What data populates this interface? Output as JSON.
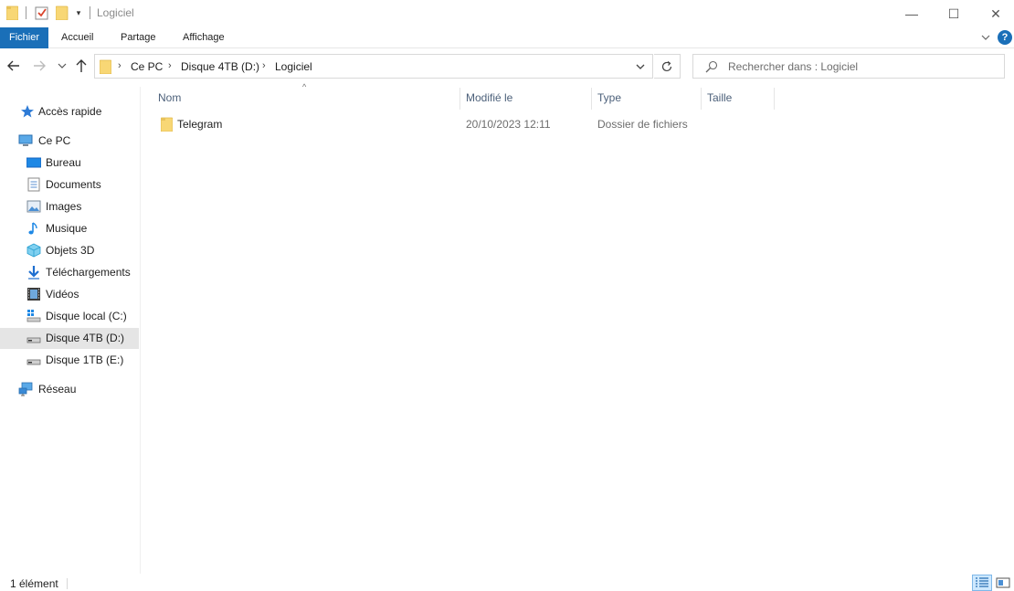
{
  "window": {
    "title": "Logiciel",
    "minimize_glyph": "—",
    "maximize_glyph": "☐",
    "close_glyph": "✕"
  },
  "ribbon": {
    "tabs": [
      "Fichier",
      "Accueil",
      "Partage",
      "Affichage"
    ],
    "active_color": "#1a6fb8",
    "help_glyph": "?"
  },
  "address": {
    "breadcrumbs": [
      "Ce PC",
      "Disque 4TB (D:)",
      "Logiciel"
    ],
    "separator": "›"
  },
  "search": {
    "placeholder": "Rechercher dans : Logiciel"
  },
  "nav": {
    "quick_access": "Accès rapide",
    "this_pc": "Ce PC",
    "items": [
      {
        "label": "Bureau",
        "icon": "desktop-icon"
      },
      {
        "label": "Documents",
        "icon": "documents-icon"
      },
      {
        "label": "Images",
        "icon": "pictures-icon"
      },
      {
        "label": "Musique",
        "icon": "music-icon"
      },
      {
        "label": "Objets 3D",
        "icon": "objects-3d-icon"
      },
      {
        "label": "Téléchargements",
        "icon": "downloads-icon"
      },
      {
        "label": "Vidéos",
        "icon": "videos-icon"
      },
      {
        "label": "Disque local (C:)",
        "icon": "system-drive-icon"
      },
      {
        "label": "Disque 4TB (D:)",
        "icon": "drive-icon",
        "selected": true
      },
      {
        "label": "Disque 1TB (E:)",
        "icon": "drive-icon"
      }
    ],
    "network": "Réseau"
  },
  "columns": [
    "Nom",
    "Modifié le",
    "Type",
    "Taille"
  ],
  "files": [
    {
      "name": "Telegram",
      "modified": "20/10/2023 12:11",
      "type": "Dossier de fichiers",
      "size": ""
    }
  ],
  "status": {
    "count_text": "1 élément"
  },
  "colors": {
    "folder": "#f8d775",
    "accent": "#1a6fb8",
    "selection": "#cde8ff"
  }
}
